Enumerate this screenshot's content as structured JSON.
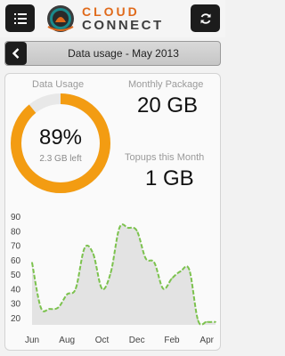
{
  "header": {
    "logo_line1": "CLOUD",
    "logo_line2": "CONNECT",
    "menu_icon": "list-icon",
    "refresh_icon": "refresh-icon"
  },
  "titlebar": {
    "title": "Data usage - May 2013",
    "back_icon": "chevron-left-icon"
  },
  "usage": {
    "label": "Data Usage",
    "percent_text": "89%",
    "percent_value": 89,
    "left_text": "2.3 GB left"
  },
  "package": {
    "label": "Monthly Package",
    "value": "20 GB"
  },
  "topups": {
    "label": "Topups this Month",
    "value": "1 GB"
  },
  "colors": {
    "accent": "#f39c12",
    "track": "#e8e8e8",
    "line": "#7cc24e",
    "area": "#e3e3e3",
    "button": "#1c1c1c"
  },
  "chart_data": {
    "type": "area",
    "y_ticks": [
      "90",
      "80",
      "70",
      "60",
      "50",
      "40",
      "30",
      "20"
    ],
    "ylim": [
      15,
      90
    ],
    "x_tick_labels": [
      "Jun",
      "Aug",
      "Oct",
      "Dec",
      "Feb",
      "Apr"
    ],
    "x": [
      0,
      1,
      2,
      3,
      4,
      5,
      6,
      7,
      8,
      9,
      10,
      11,
      12,
      13,
      14,
      15,
      16,
      17,
      18,
      19,
      20,
      21
    ],
    "values": [
      58,
      27,
      26,
      27,
      36,
      40,
      68,
      64,
      40,
      51,
      82,
      82,
      80,
      61,
      58,
      40,
      47,
      52,
      53,
      18,
      17,
      17
    ],
    "grid": false
  }
}
